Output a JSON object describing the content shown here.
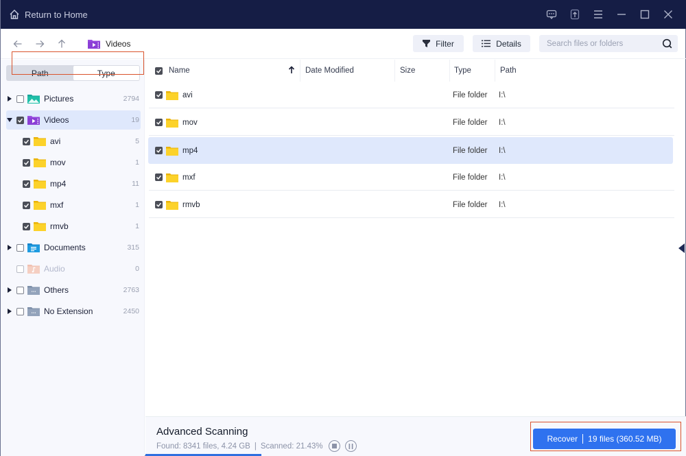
{
  "titlebar": {
    "home_label": "Return to Home",
    "icons": [
      "feedback-icon",
      "upload-icon",
      "menu-icon",
      "minimize-icon",
      "maximize-icon",
      "close-icon"
    ]
  },
  "toolbar": {
    "breadcrumb": "Videos",
    "filter_label": "Filter",
    "details_label": "Details",
    "search_placeholder": "Search files or folders",
    "search_value": ""
  },
  "sidebar": {
    "tabs": [
      {
        "label": "Path",
        "active": false
      },
      {
        "label": "Type",
        "active": true
      }
    ],
    "items": [
      {
        "label": "Pictures",
        "count": "2794",
        "checked": false,
        "expandable": true,
        "icon": "pictures-folder-icon"
      },
      {
        "label": "Videos",
        "count": "19",
        "checked": true,
        "expanded": true,
        "selected": true,
        "icon": "videos-folder-icon",
        "children": [
          {
            "label": "avi",
            "count": "5",
            "checked": true
          },
          {
            "label": "mov",
            "count": "1",
            "checked": true
          },
          {
            "label": "mp4",
            "count": "11",
            "checked": true
          },
          {
            "label": "mxf",
            "count": "1",
            "checked": true
          },
          {
            "label": "rmvb",
            "count": "1",
            "checked": true
          }
        ]
      },
      {
        "label": "Documents",
        "count": "315",
        "checked": false,
        "expandable": true,
        "icon": "documents-folder-icon"
      },
      {
        "label": "Audio",
        "count": "0",
        "checked": false,
        "disabled": true,
        "icon": "audio-folder-icon"
      },
      {
        "label": "Others",
        "count": "2763",
        "checked": false,
        "expandable": true,
        "icon": "others-folder-icon"
      },
      {
        "label": "No Extension",
        "count": "2450",
        "checked": false,
        "expandable": true,
        "icon": "no-extension-folder-icon"
      }
    ]
  },
  "table": {
    "columns": [
      "Name",
      "Date Modified",
      "Size",
      "Type",
      "Path"
    ],
    "sort": {
      "column": "Name",
      "direction": "ascending"
    },
    "rows": [
      {
        "name": "avi",
        "date": "",
        "size": "",
        "type": "File folder",
        "path": "I:\\",
        "checked": true
      },
      {
        "name": "mov",
        "date": "",
        "size": "",
        "type": "File folder",
        "path": "I:\\",
        "checked": true
      },
      {
        "name": "mp4",
        "date": "",
        "size": "",
        "type": "File folder",
        "path": "I:\\",
        "checked": true,
        "selected": true
      },
      {
        "name": "mxf",
        "date": "",
        "size": "",
        "type": "File folder",
        "path": "I:\\",
        "checked": true
      },
      {
        "name": "rmvb",
        "date": "",
        "size": "",
        "type": "File folder",
        "path": "I:\\",
        "checked": true
      }
    ]
  },
  "bottom": {
    "scan_title": "Advanced Scanning",
    "found": "Found: 8341 files, 4.24 GB",
    "divider": "|",
    "scanned": "Scanned: 21.43%",
    "progress_percent": 21.43,
    "recover_label": "Recover",
    "recover_summary": "19 files (360.52 MB)"
  },
  "colors": {
    "titlebar": "#151d45",
    "accent": "#2f72ef",
    "selection": "#dfe8fc",
    "highlight_outline": "#d9532c",
    "folder": "#f9c513",
    "videos_icon": "#9b4fe0"
  }
}
